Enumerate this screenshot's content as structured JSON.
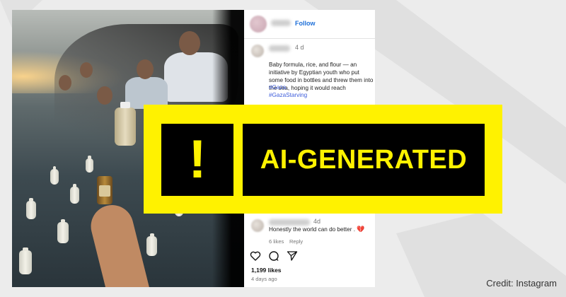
{
  "post": {
    "follow_label": "Follow",
    "caption_time": "4 d",
    "caption": "Baby formula, rice, and flour — an initiative by Egyptian youth who put some food in bottles and threw them into the sea, hoping it would reach",
    "hashtags": [
      "#Gaza.",
      "#GazaStarving"
    ],
    "comment": {
      "time": "4d",
      "text": "Honestly the world can do better .",
      "emoji": "💔",
      "likes": "6 likes",
      "reply_label": "Reply"
    },
    "likes": "1,199 likes",
    "posted": "4 days ago",
    "carousel_dots": "•••"
  },
  "banner": {
    "icon": "!",
    "label": "AI-GENERATED",
    "color": "#fff200"
  },
  "credit": "Credit: Instagram"
}
